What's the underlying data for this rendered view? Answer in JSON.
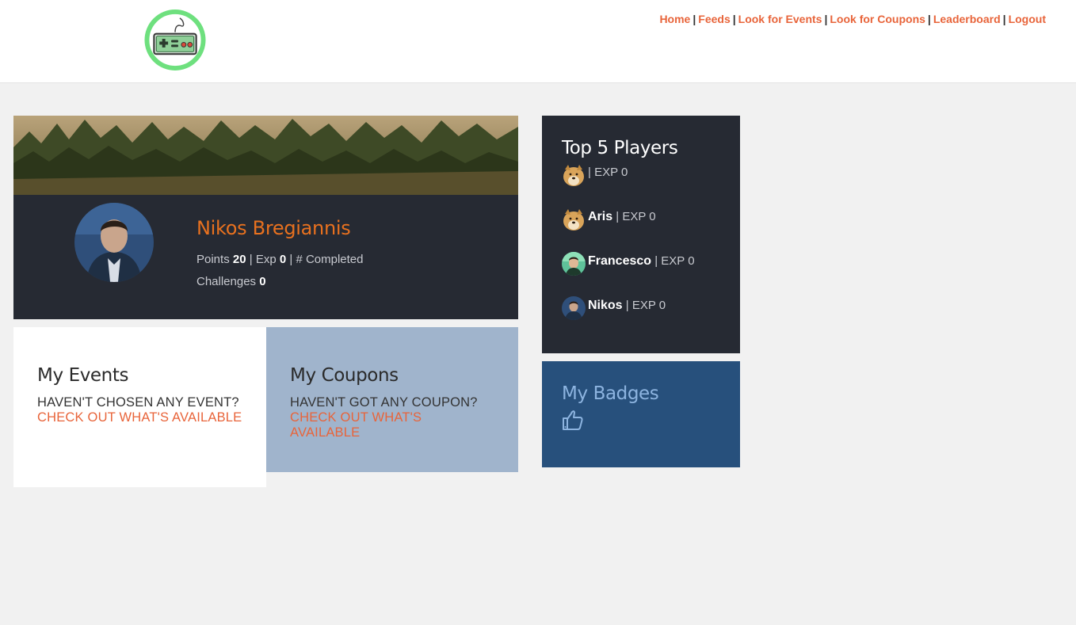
{
  "nav": {
    "items": [
      "Home",
      "Feeds",
      "Look for Events",
      "Look for Coupons",
      "Leaderboard",
      "Logout"
    ],
    "separator": "|"
  },
  "profile": {
    "name": "Nikos Bregiannis",
    "points_label": "Points",
    "points_value": "20",
    "exp_label": "Exp",
    "exp_value": "0",
    "completed_label": "# Completed Challenges",
    "completed_value": "0",
    "sep": "|"
  },
  "events": {
    "title": "My Events",
    "message": "Haven't chosen any event?",
    "link": "Check out what's available"
  },
  "coupons": {
    "title": "My Coupons",
    "message": "Haven't got any coupon?",
    "link": "Check out what's available"
  },
  "top_players": {
    "title": "Top 5 Players",
    "players": [
      {
        "name": "",
        "exp": "| EXP 0",
        "avatar": "doge"
      },
      {
        "name": "Aris",
        "exp": "| EXP 0",
        "avatar": "doge"
      },
      {
        "name": "Francesco",
        "exp": "| EXP 0",
        "avatar": "photo-green"
      },
      {
        "name": "Nikos",
        "exp": "| EXP 0",
        "avatar": "photo-blue"
      }
    ]
  },
  "badges": {
    "title": "My Badges",
    "icon": "thumbs-up-icon"
  },
  "colors": {
    "accent": "#e8643a",
    "name_orange": "#e8711f",
    "dark_panel": "#262a33",
    "coupons_bg": "#a0b4cc",
    "badges_bg": "#27507c",
    "badges_title": "#8db4e0",
    "logo_green": "#6ee07e"
  }
}
